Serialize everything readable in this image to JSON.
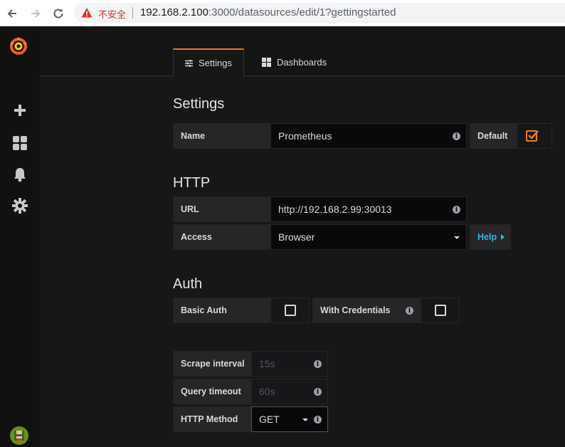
{
  "browser": {
    "insecure_label": "不安全",
    "url_host": "192.168.2.100",
    "url_rest": ":3000/datasources/edit/1?gettingstarted"
  },
  "sidebar": {
    "icons": [
      "grafana-logo-icon",
      "plus-icon",
      "dashboards-icon",
      "bell-icon",
      "gear-icon",
      "avatar"
    ]
  },
  "tabs": {
    "settings": "Settings",
    "dashboards": "Dashboards"
  },
  "settings": {
    "heading": "Settings",
    "name_label": "Name",
    "name_value": "Prometheus",
    "default_label": "Default",
    "default_checked": true
  },
  "http": {
    "heading": "HTTP",
    "url_label": "URL",
    "url_value": "http://192.168.2.99:30013",
    "access_label": "Access",
    "access_value": "Browser",
    "help_label": "Help"
  },
  "auth": {
    "heading": "Auth",
    "basic_auth_label": "Basic Auth",
    "with_credentials_label": "With Credentials"
  },
  "prom": {
    "scrape_label": "Scrape interval",
    "scrape_placeholder": "15s",
    "timeout_label": "Query timeout",
    "timeout_placeholder": "60s",
    "method_label": "HTTP Method",
    "method_value": "GET"
  },
  "colors": {
    "accent": "#eb7b18",
    "link": "#33b5e5"
  }
}
